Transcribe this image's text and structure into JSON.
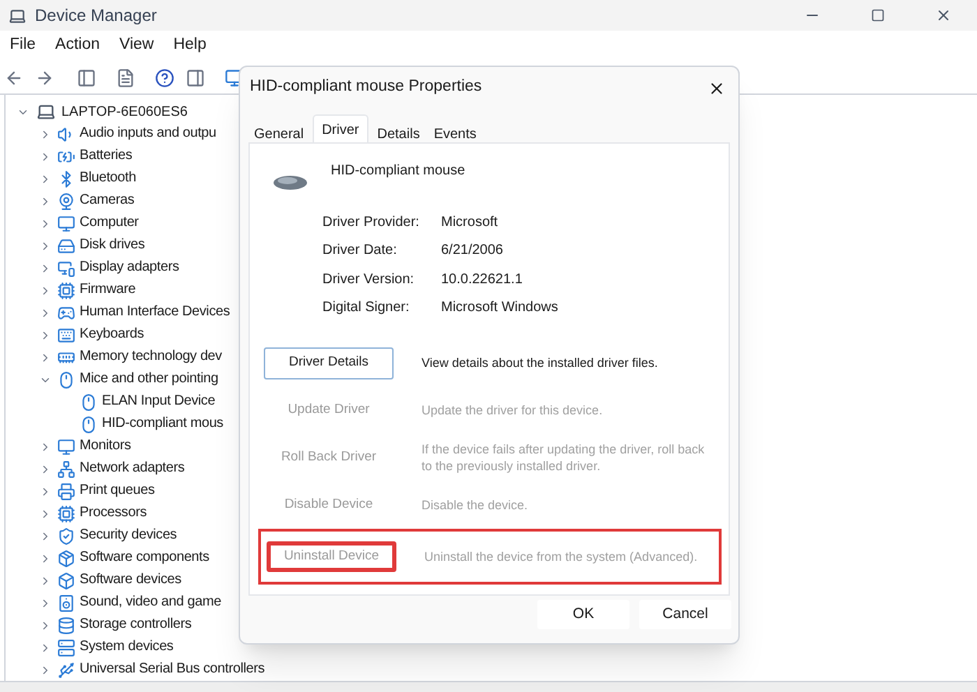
{
  "window": {
    "title": "Device Manager"
  },
  "menu": [
    "File",
    "Action",
    "View",
    "Help"
  ],
  "tree": {
    "label": "LAPTOP-6E060ES6",
    "expanded": true,
    "children": [
      {
        "label": "Audio inputs and outpu",
        "expanded": false
      },
      {
        "label": "Batteries",
        "expanded": false
      },
      {
        "label": "Bluetooth",
        "expanded": false
      },
      {
        "label": "Cameras",
        "expanded": false
      },
      {
        "label": "Computer",
        "expanded": false
      },
      {
        "label": "Disk drives",
        "expanded": false
      },
      {
        "label": "Display adapters",
        "expanded": false
      },
      {
        "label": "Firmware",
        "expanded": false
      },
      {
        "label": "Human Interface Devices",
        "expanded": false
      },
      {
        "label": "Keyboards",
        "expanded": false
      },
      {
        "label": "Memory technology dev",
        "expanded": false
      },
      {
        "label": "Mice and other pointing",
        "expanded": true,
        "children": [
          {
            "label": "ELAN Input Device"
          },
          {
            "label": "HID-compliant mous"
          }
        ]
      },
      {
        "label": "Monitors",
        "expanded": false
      },
      {
        "label": "Network adapters",
        "expanded": false
      },
      {
        "label": "Print queues",
        "expanded": false
      },
      {
        "label": "Processors",
        "expanded": false
      },
      {
        "label": "Security devices",
        "expanded": false
      },
      {
        "label": "Software components",
        "expanded": false
      },
      {
        "label": "Software devices",
        "expanded": false
      },
      {
        "label": "Sound, video and game",
        "expanded": false
      },
      {
        "label": "Storage controllers",
        "expanded": false
      },
      {
        "label": "System devices",
        "expanded": false
      },
      {
        "label": "Universal Serial Bus controllers",
        "expanded": false
      }
    ]
  },
  "dialog": {
    "title": "HID-compliant mouse Properties",
    "tabs": [
      {
        "label": "General",
        "selected": false
      },
      {
        "label": "Driver",
        "selected": true
      },
      {
        "label": "Details",
        "selected": false
      },
      {
        "label": "Events",
        "selected": false
      }
    ],
    "device_name": "HID-compliant mouse",
    "properties": [
      {
        "label": "Driver Provider:",
        "value": "Microsoft"
      },
      {
        "label": "Driver Date:",
        "value": "6/21/2006"
      },
      {
        "label": "Driver Version:",
        "value": "10.0.22621.1"
      },
      {
        "label": "Digital Signer:",
        "value": "Microsoft Windows"
      }
    ],
    "actions": [
      {
        "button": "Driver Details",
        "description": "View details about the installed driver files.",
        "disabled": false,
        "highlighted": false
      },
      {
        "button": "Update Driver",
        "description": "Update the driver for this device.",
        "disabled": true,
        "highlighted": false
      },
      {
        "button": "Roll Back Driver",
        "description": "If the device fails after updating the driver, roll back to the previously installed driver.",
        "disabled": true,
        "highlighted": false
      },
      {
        "button": "Disable Device",
        "description": "Disable the device.",
        "disabled": true,
        "highlighted": false
      },
      {
        "button": "Uninstall Device",
        "description": "Uninstall the device from the system (Advanced).",
        "disabled": true,
        "highlighted": true
      }
    ],
    "buttons": [
      "OK",
      "Cancel"
    ]
  }
}
